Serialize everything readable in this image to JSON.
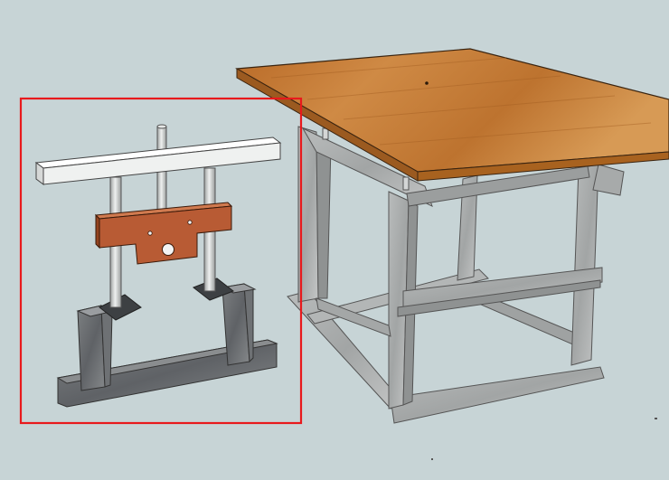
{
  "scene": {
    "background": "#c7d4d6",
    "selection_color": "#e8191c",
    "tabletop_color": "#c1752f",
    "steel_color": "#a9abab",
    "steel_shadow": "#8e9191",
    "crossbar_color": "#f3f4f3",
    "block_color": "#b85b34",
    "pillar_color": "#d5d8d7"
  },
  "objects": [
    {
      "name": "selected-component-group"
    },
    {
      "name": "router-lift-assembly"
    },
    {
      "name": "workbench-frame"
    },
    {
      "name": "workbench-top"
    }
  ]
}
